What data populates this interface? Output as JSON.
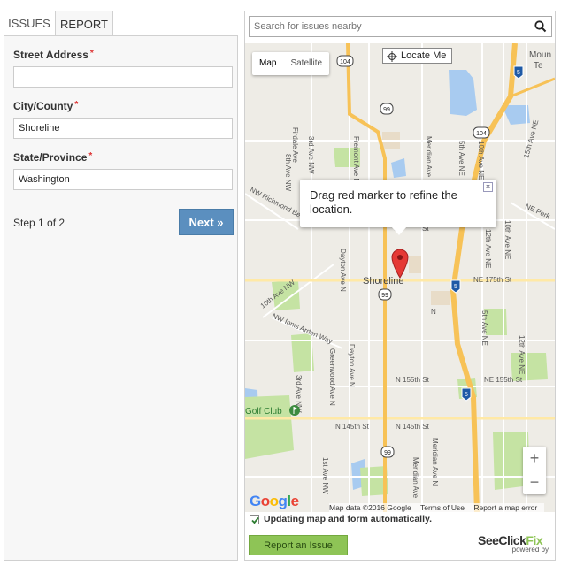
{
  "tabs": [
    {
      "label": "ISSUES"
    },
    {
      "label": "REPORT"
    }
  ],
  "form": {
    "street": {
      "label": "Street Address",
      "value": ""
    },
    "city": {
      "label": "City/County",
      "value": "Shoreline"
    },
    "state": {
      "label": "State/Province",
      "value": "Washington"
    },
    "required_mark": "*",
    "step": "Step 1 of 2",
    "next_label": "Next »"
  },
  "search": {
    "placeholder": "Search for issues nearby",
    "icon": "search-icon"
  },
  "map": {
    "type_map": "Map",
    "type_satellite": "Satellite",
    "locate_label": "Locate Me",
    "popup_text": "Drag red marker to refine the location.",
    "popup_close": "×",
    "zoom_in": "+",
    "zoom_out": "−",
    "logo": "Google",
    "attribution": {
      "data": "Map data ©2016 Google",
      "terms": "Terms of Use",
      "report": "Report a map error"
    },
    "labels": {
      "city": "Shoreline",
      "golf": "Golf Club",
      "mount": "Moun",
      "te": "Te",
      "shield_104": "104",
      "shield_99a": "99",
      "shield_99b": "99",
      "shield_99c": "99",
      "shield_5a": "5",
      "shield_5b": "5",
      "shield_5c": "5",
      "shield_104b": "104",
      "richmond": "NW Richmond Be",
      "innis": "NW Innis Arden Way",
      "tenth_nw": "10th Ave NW",
      "firdale": "Firdale Ave",
      "eighth_nw": "8th Ave NW",
      "third_nw": "3rd Ave NW",
      "third_nw_b": "3rd Ave NW",
      "first_nw": "1st Ave NW",
      "fremont": "Fremont Ave N",
      "dayton": "Dayton Ave N",
      "dayton_b": "Dayton Ave N",
      "greenwood": "Greenwood Ave N",
      "meridian": "Meridian Ave N",
      "meridian_b": "Meridian Ave N",
      "meridian_c": "Meridian Ave",
      "fifth_ne": "5th Ave NE",
      "fifth_ne_b": "5th Ave NE",
      "tenth_ne": "10th Ave NE",
      "tenth_ne_b": "10th Ave NE",
      "twelfth_ne": "12th Ave NE",
      "twelfth_ne_b": "12th Ave NE",
      "fifteenth_ne": "15th Ave NE",
      "ne_perk": "NE Perk",
      "ne175": "NE 175th St",
      "n155": "N 155th St",
      "ne155": "NE 155th St",
      "n145a": "N 145th St",
      "n145b": "N 145th St",
      "st_a": "St",
      "st_b": "St",
      "n_short": "N"
    }
  },
  "auto_update": {
    "label": "Updating map and form automatically.",
    "checked": true
  },
  "report_button": "Report an Issue",
  "brand": {
    "see": "See",
    "click": "Click",
    "fix": "Fix",
    "powered": "powered by"
  },
  "colors": {
    "next": "#5b8fbf",
    "report": "#8ec456",
    "marker": "#e53935",
    "highway": "#f7c257",
    "road": "#ffffff",
    "park": "#c5e3a3",
    "water": "#a8cbf0"
  }
}
